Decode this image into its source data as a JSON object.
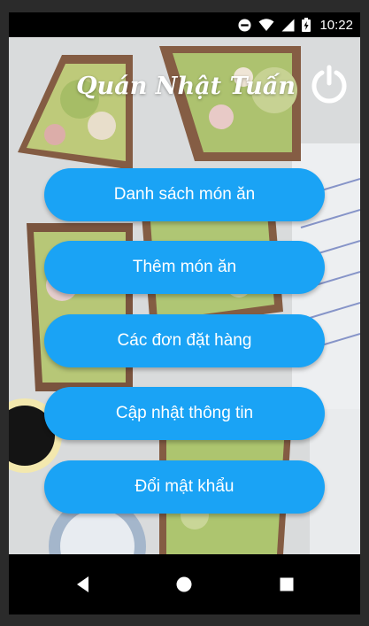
{
  "status_bar": {
    "time": "10:22",
    "icons": [
      "do-not-disturb-icon",
      "wifi-icon",
      "signal-icon",
      "battery-charging-icon"
    ]
  },
  "header": {
    "title": "Quán Nhật Tuấn",
    "power_icon": "power-icon"
  },
  "background": {
    "watermark_text": "avocado toast"
  },
  "menu": {
    "items": [
      {
        "label": "Danh sách món ăn"
      },
      {
        "label": "Thêm món ăn"
      },
      {
        "label": "Các đơn đặt hàng"
      },
      {
        "label": "Cập nhật thông tin"
      },
      {
        "label": "Đổi mật khẩu"
      }
    ]
  },
  "nav_bar": {
    "buttons": [
      "back-icon",
      "home-icon",
      "recents-icon"
    ]
  },
  "colors": {
    "button": "#1aa3f5",
    "button_text": "#ffffff",
    "title": "#ffffff",
    "bars": "#000000"
  }
}
